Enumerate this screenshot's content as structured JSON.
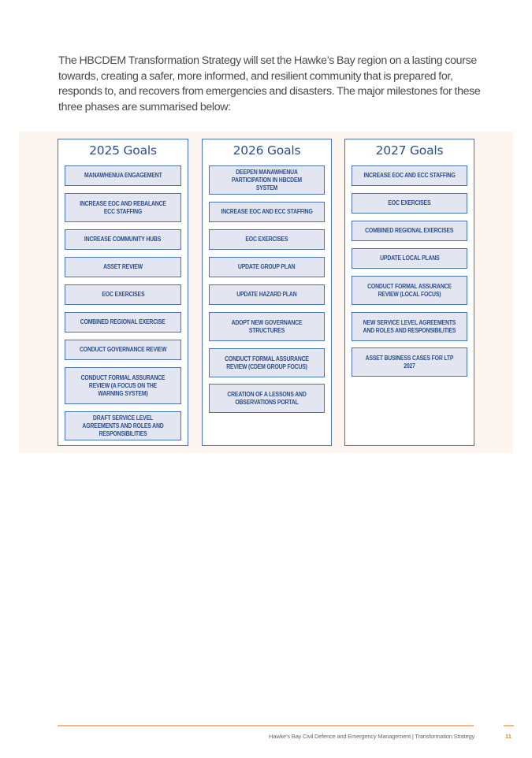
{
  "intro": "The HBCDEM Transformation Strategy will set the Hawke’s Bay region on a lasting course towards, creating a safer, more informed, and resilient community that is prepared for, responds to, and recovers from emergencies and disasters. The major milestones for these three phases are summarised below:",
  "columns": [
    {
      "title": "2025 Goals",
      "goals": [
        "MANAWHENUA ENGAGEMENT",
        "INCREASE EOC AND REBALANCE ECC STAFFING",
        "INCREASE COMMUNITY HUBS",
        "ASSET REVIEW",
        "EOC EXERCISES",
        "COMBINED REGIONAL EXERCISE",
        "CONDUCT GOVERNANCE REVIEW",
        "CONDUCT FORMAL ASSURANCE REVIEW (A FOCUS ON THE WARNING SYSTEM)",
        "DRAFT SERVICE LEVEL AGREEMENTS AND ROLES AND RESPONSIBILITIES"
      ]
    },
    {
      "title": "2026 Goals",
      "goals": [
        "DEEPEN MANAWHENUA PARTICIPATION IN HBCDEM SYSTEM",
        "INCREASE EOC AND ECC STAFFING",
        "EOC EXERCISES",
        "UPDATE GROUP PLAN",
        "UPDATE HAZARD PLAN",
        "ADOPT NEW GOVERNANCE STRUCTURES",
        "CONDUCT FORMAL ASSURANCE REVIEW (CDEM GROUP FOCUS)",
        "CREATION OF A LESSONS AND OBSERVATIONS PORTAL"
      ]
    },
    {
      "title": "2027 Goals",
      "goals": [
        "INCREASE EOC AND ECC STAFFING",
        "EOC EXERCISES",
        "COMBINED REGIONAL EXERCISES",
        "UPDATE LOCAL PLANS",
        "CONDUCT FORMAL ASSURANCE REVIEW (LOCAL FOCUS)",
        "NEW SERVICE LEVEL AGREEMENTS AND ROLES AND RESPONSIBILITIES",
        "ASSET BUSINESS CASES FOR LTP 2027"
      ]
    }
  ],
  "footer": {
    "text": "Hawke’s Bay Civil Defence and Emergency Management  |  Transformation Strategy",
    "page_number": "11"
  }
}
